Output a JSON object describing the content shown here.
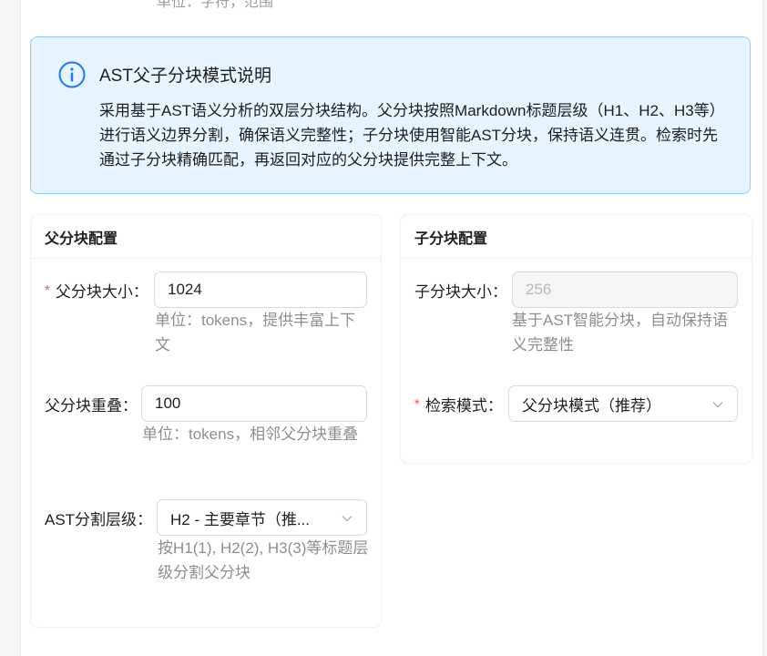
{
  "top_partial_text": "单位：字符，范围",
  "alert": {
    "icon": "info-circle-icon",
    "title": "AST父子分块模式说明",
    "description": "采用基于AST语义分析的双层分块结构。父分块按照Markdown标题层级（H1、H2、H3等）进行语义边界分割，确保语义完整性；子分块使用智能AST分块，保持语义连贯。检索时先通过子分块精确匹配，再返回对应的父分块提供完整上下文。"
  },
  "parent_card": {
    "title": "父分块配置",
    "size": {
      "label": "父分块大小",
      "required": true,
      "value": "1024",
      "help": "单位：tokens，提供丰富上下文"
    },
    "overlap": {
      "label": "父分块重叠",
      "required": false,
      "value": "100",
      "help": "单位：tokens，相邻父分块重叠"
    },
    "ast_level": {
      "label": "AST分割层级",
      "required": false,
      "value": "H2 - 主要章节（推...",
      "help": "按H1(1), H2(2), H3(3)等标题层级分割父分块"
    }
  },
  "child_card": {
    "title": "子分块配置",
    "size": {
      "label": "子分块大小",
      "required": false,
      "value": "256",
      "disabled": true,
      "help": "基于AST智能分块，自动保持语义完整性"
    },
    "retrieval_mode": {
      "label": "检索模式",
      "required": true,
      "value": "父分块模式（推荐）"
    }
  },
  "colors": {
    "accent": "#1677ff",
    "alert_bg": "#e6f4ff",
    "alert_border": "#91caff",
    "required": "#ff4d4f"
  }
}
